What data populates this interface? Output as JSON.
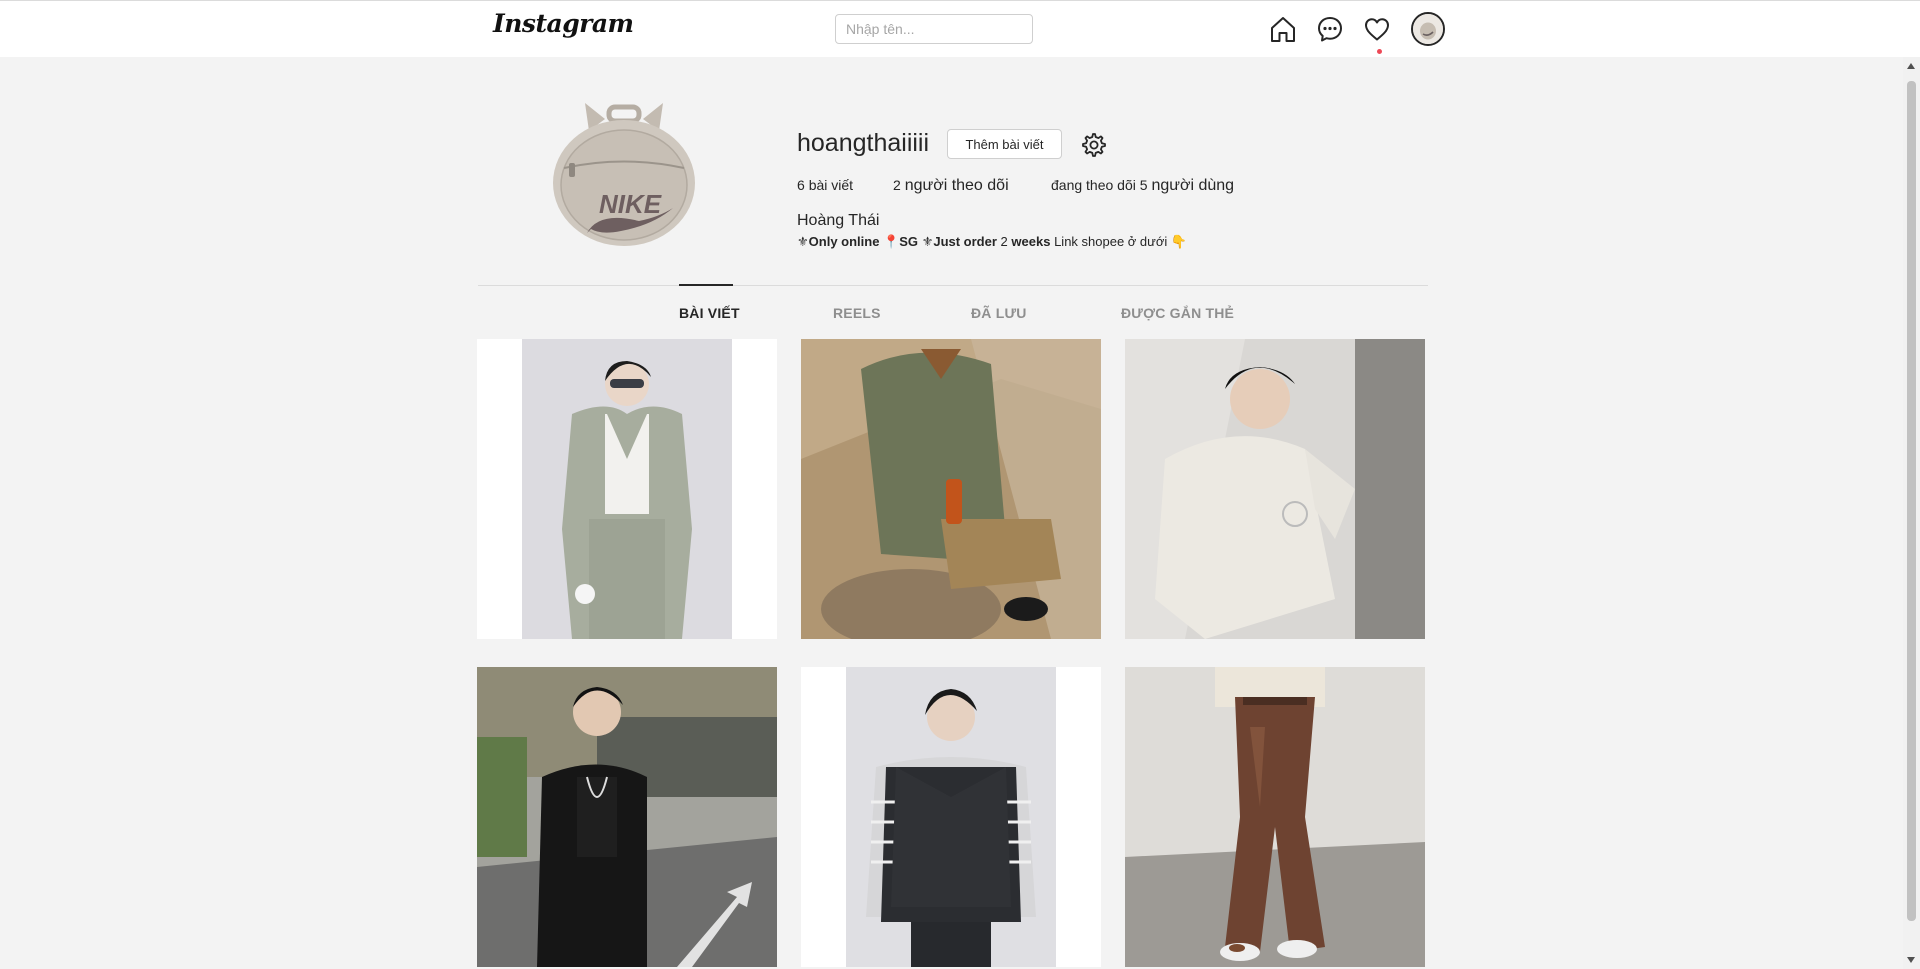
{
  "header": {
    "logo": "Instagram",
    "search_placeholder": "Nhập tên...",
    "icons": [
      "home-icon",
      "messenger-icon",
      "heart-icon"
    ]
  },
  "profile": {
    "username": "hoangthaiiiii",
    "add_post_label": "Thêm bài viết",
    "stats": {
      "posts_count": "6",
      "posts_label": "bài viết",
      "followers_count": "2",
      "followers_label": "người theo dõi",
      "following_prefix": "đang theo dõi",
      "following_count": "5",
      "following_label": "người dùng"
    },
    "full_name": "Hoàng Thái",
    "bio": {
      "part1": "Only online",
      "part2": "SG",
      "part3": "Just order",
      "part4": "2",
      "part5": "weeks",
      "part6": "Link shopee ở dưới"
    }
  },
  "tabs": [
    {
      "label": "BÀI VIẾT",
      "active": true
    },
    {
      "label": "REELS",
      "active": false
    },
    {
      "label": "ĐÃ LƯU",
      "active": false
    },
    {
      "label": "ĐƯỢC GẮN THẺ",
      "active": false
    }
  ],
  "colors": {
    "background": "#f3f3f3",
    "accent_dot": "#ed4956",
    "text": "#262626",
    "muted": "#8e8e8e"
  }
}
